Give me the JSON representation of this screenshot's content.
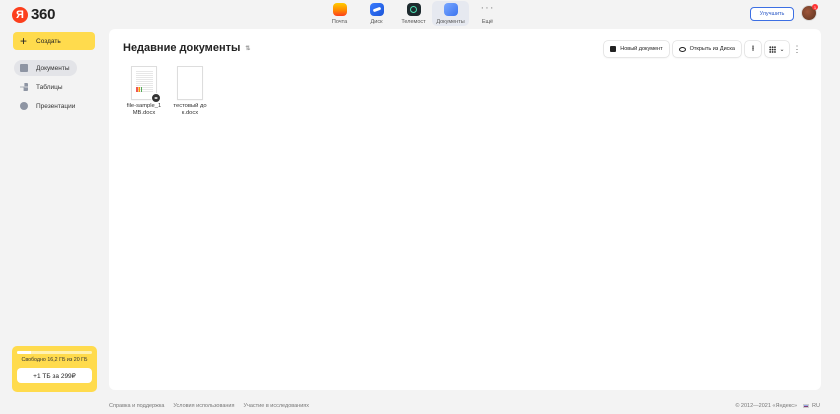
{
  "logo": {
    "ya": "Я",
    "brand": "360"
  },
  "apps": [
    {
      "label": "Почта",
      "icon": "mail-icon"
    },
    {
      "label": "Диск",
      "icon": "disk-icon"
    },
    {
      "label": "Телемост",
      "icon": "telemost-icon"
    },
    {
      "label": "Документы",
      "icon": "documents-icon",
      "active": true
    },
    {
      "label": "Ещё",
      "icon": "more-icon"
    }
  ],
  "header": {
    "upgrade_label": "Улучшить",
    "notification_count": "1"
  },
  "sidebar": {
    "create_label": "Создать",
    "items": [
      {
        "label": "Документы",
        "active": true
      },
      {
        "label": "Таблицы"
      },
      {
        "label": "Презентации"
      }
    ],
    "storage": {
      "free_text": "Свободно 16,2 ГБ из 20 ГБ",
      "used_fraction": 0.19,
      "buy_label": "+1 ТБ за 299₽"
    }
  },
  "main": {
    "title": "Недавние документы",
    "toolbar": {
      "new_doc": "Новый документ",
      "open_disk": "Открыть из Диска"
    },
    "files": [
      {
        "name": "file-sample_1MB.docx",
        "shared": true
      },
      {
        "name": "тестовый док.docx",
        "shared": false
      }
    ]
  },
  "footer": {
    "links": [
      "Справка и поддержка",
      "Условия использования",
      "Участие в исследованиях"
    ],
    "copyright": "© 2012—2021 «Яндекс»",
    "lang": "RU"
  },
  "colors": {
    "accent_yellow": "#ffdb4d",
    "link_blue": "#3c6fe3",
    "brand_red": "#fc3f1d"
  }
}
